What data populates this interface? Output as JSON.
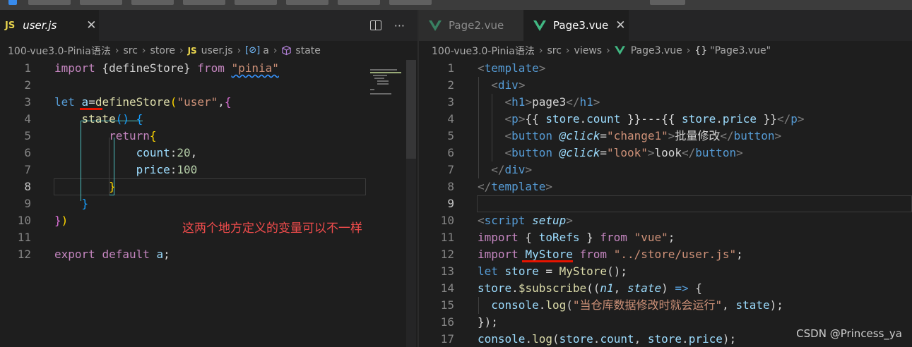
{
  "left": {
    "tab": {
      "label": "user.js",
      "badge": "JS",
      "close": "✕"
    },
    "actions": {
      "more": "···"
    },
    "breadcrumb": {
      "root": "100-vue3.0-Pinia语法",
      "dir1": "src",
      "dir2": "store",
      "file_badge": "JS",
      "file": "user.js",
      "var_icon": "[⊘]",
      "var": "a",
      "prop": "state"
    },
    "line_numbers": [
      "1",
      "2",
      "3",
      "4",
      "5",
      "6",
      "7",
      "8",
      "9",
      "10",
      "11",
      "12"
    ],
    "annotation": "这两个地方定义的变量可以不一样"
  },
  "right": {
    "tabs": [
      {
        "label": "Page2.vue"
      },
      {
        "label": "Page3.vue",
        "close": "✕"
      }
    ],
    "breadcrumb": {
      "root": "100-vue3.0-Pinia语法",
      "dir1": "src",
      "dir2": "views",
      "file": "Page3.vue",
      "braces": "{}",
      "symbol": "\"Page3.vue\""
    },
    "line_numbers": [
      "1",
      "2",
      "3",
      "4",
      "5",
      "6",
      "7",
      "8",
      "9",
      "10",
      "11",
      "12",
      "13",
      "14",
      "15",
      "16",
      "17"
    ]
  },
  "watermark": "CSDN @Princess_ya",
  "colors": {
    "keyword": "#c586c0",
    "string": "#ce9178",
    "function": "#dcdcaa",
    "variable": "#9cdcfe",
    "number": "#b5cea8",
    "annotation": "#f14c4c",
    "js_badge": "#e8d44d",
    "vue": "#41b883"
  }
}
